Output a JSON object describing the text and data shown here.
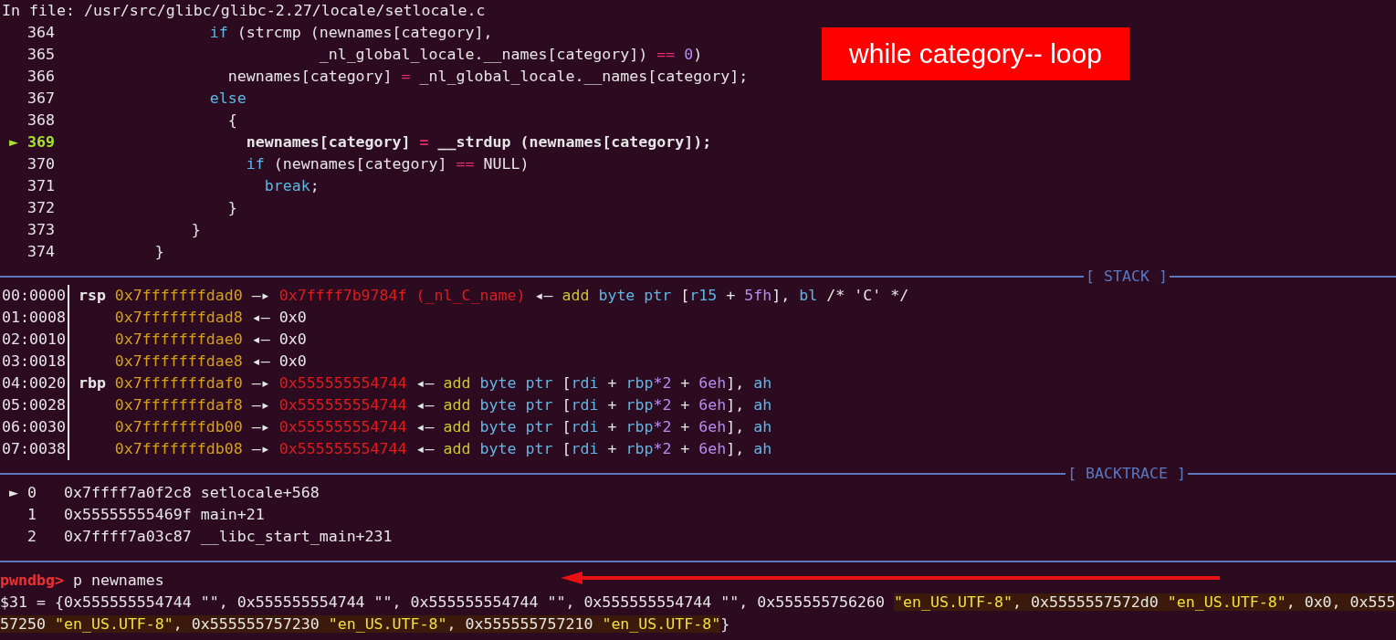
{
  "header": "In file: /usr/src/glibc/glibc-2.27/locale/setlocale.c",
  "source": [
    {
      "number": "364",
      "current": false,
      "tokens": [
        {
          "kind": "keyword",
          "text": "                 if"
        },
        {
          "kind": "plain",
          "text": " (strcmp (newnames[category],"
        }
      ]
    },
    {
      "number": "365",
      "current": false,
      "tokens": [
        {
          "kind": "plain",
          "text": "                             _nl_global_locale.__names[category]) "
        },
        {
          "kind": "operator",
          "text": "=="
        },
        {
          "kind": "number",
          "text": " 0"
        },
        {
          "kind": "plain",
          "text": ")"
        }
      ]
    },
    {
      "number": "366",
      "current": false,
      "tokens": [
        {
          "kind": "plain",
          "text": "                   newnames[category] "
        },
        {
          "kind": "operator",
          "text": "="
        },
        {
          "kind": "plain",
          "text": " _nl_global_locale.__names[category];"
        }
      ]
    },
    {
      "number": "367",
      "current": false,
      "tokens": [
        {
          "kind": "keyword",
          "text": "                 else"
        }
      ]
    },
    {
      "number": "368",
      "current": false,
      "tokens": [
        {
          "kind": "plain",
          "text": "                   {"
        }
      ]
    },
    {
      "marker": "►",
      "number": "369",
      "current": true,
      "tokens": [
        {
          "kind": "plain",
          "text": "                     newnames[category] "
        },
        {
          "kind": "operator",
          "text": "="
        },
        {
          "kind": "plain",
          "text": " __strdup (newnames[category]);"
        }
      ]
    },
    {
      "number": "370",
      "current": false,
      "tokens": [
        {
          "kind": "keyword",
          "text": "                     if"
        },
        {
          "kind": "plain",
          "text": " (newnames[category] "
        },
        {
          "kind": "operator",
          "text": "=="
        },
        {
          "kind": "plain",
          "text": " NULL)"
        }
      ]
    },
    {
      "number": "371",
      "current": false,
      "tokens": [
        {
          "kind": "keyword",
          "text": "                       break"
        },
        {
          "kind": "plain",
          "text": ";"
        }
      ]
    },
    {
      "number": "372",
      "current": false,
      "tokens": [
        {
          "kind": "plain",
          "text": "                   }"
        }
      ]
    },
    {
      "number": "373",
      "current": false,
      "tokens": [
        {
          "kind": "plain",
          "text": "               }"
        }
      ]
    },
    {
      "number": "374",
      "current": false,
      "tokens": [
        {
          "kind": "plain",
          "text": "           }"
        }
      ]
    }
  ],
  "stack": {
    "title": "[ STACK ]",
    "rows": [
      {
        "offset": "00:0000",
        "register": "rsp",
        "tokens": [
          {
            "kind": "stack",
            "text": "0x7fffffffdad0"
          },
          {
            "kind": "plain",
            "text": " —▸ "
          },
          {
            "kind": "heap",
            "text": "0x7ffff7b9784f (_nl_C_name)"
          },
          {
            "kind": "plain",
            "text": " ◂— "
          },
          {
            "kind": "mnemonic",
            "text": "add"
          },
          {
            "kind": "operand",
            "text": " byte ptr "
          },
          {
            "kind": "plain",
            "text": "["
          },
          {
            "kind": "operand",
            "text": "r15"
          },
          {
            "kind": "plain",
            "text": " + "
          },
          {
            "kind": "number",
            "text": "5fh"
          },
          {
            "kind": "plain",
            "text": "], "
          },
          {
            "kind": "operand",
            "text": "bl"
          },
          {
            "kind": "plain",
            "text": " /* 'C' */"
          }
        ]
      },
      {
        "offset": "01:0008",
        "tokens": [
          {
            "kind": "stack",
            "text": "0x7fffffffdad8"
          },
          {
            "kind": "plain",
            "text": " ◂— 0x0"
          }
        ]
      },
      {
        "offset": "02:0010",
        "tokens": [
          {
            "kind": "stack",
            "text": "0x7fffffffdae0"
          },
          {
            "kind": "plain",
            "text": " ◂— 0x0"
          }
        ]
      },
      {
        "offset": "03:0018",
        "tokens": [
          {
            "kind": "stack",
            "text": "0x7fffffffdae8"
          },
          {
            "kind": "plain",
            "text": " ◂— 0x0"
          }
        ]
      },
      {
        "offset": "04:0020",
        "register": "rbp",
        "tokens": [
          {
            "kind": "stack",
            "text": "0x7fffffffdaf0"
          },
          {
            "kind": "plain",
            "text": " —▸ "
          },
          {
            "kind": "heap",
            "text": "0x555555554744"
          },
          {
            "kind": "plain",
            "text": " ◂— "
          },
          {
            "kind": "mnemonic",
            "text": "add"
          },
          {
            "kind": "operand",
            "text": " byte ptr "
          },
          {
            "kind": "plain",
            "text": "["
          },
          {
            "kind": "operand",
            "text": "rdi"
          },
          {
            "kind": "plain",
            "text": " + "
          },
          {
            "kind": "operand",
            "text": "rbp"
          },
          {
            "kind": "number",
            "text": "*2"
          },
          {
            "kind": "plain",
            "text": " + "
          },
          {
            "kind": "number",
            "text": "6eh"
          },
          {
            "kind": "plain",
            "text": "], "
          },
          {
            "kind": "operand",
            "text": "ah"
          }
        ]
      },
      {
        "offset": "05:0028",
        "tokens": [
          {
            "kind": "stack",
            "text": "0x7fffffffdaf8"
          },
          {
            "kind": "plain",
            "text": " —▸ "
          },
          {
            "kind": "heap",
            "text": "0x555555554744"
          },
          {
            "kind": "plain",
            "text": " ◂— "
          },
          {
            "kind": "mnemonic",
            "text": "add"
          },
          {
            "kind": "operand",
            "text": " byte ptr "
          },
          {
            "kind": "plain",
            "text": "["
          },
          {
            "kind": "operand",
            "text": "rdi"
          },
          {
            "kind": "plain",
            "text": " + "
          },
          {
            "kind": "operand",
            "text": "rbp"
          },
          {
            "kind": "number",
            "text": "*2"
          },
          {
            "kind": "plain",
            "text": " + "
          },
          {
            "kind": "number",
            "text": "6eh"
          },
          {
            "kind": "plain",
            "text": "], "
          },
          {
            "kind": "operand",
            "text": "ah"
          }
        ]
      },
      {
        "offset": "06:0030",
        "tokens": [
          {
            "kind": "stack",
            "text": "0x7fffffffdb00"
          },
          {
            "kind": "plain",
            "text": " —▸ "
          },
          {
            "kind": "heap",
            "text": "0x555555554744"
          },
          {
            "kind": "plain",
            "text": " ◂— "
          },
          {
            "kind": "mnemonic",
            "text": "add"
          },
          {
            "kind": "operand",
            "text": " byte ptr "
          },
          {
            "kind": "plain",
            "text": "["
          },
          {
            "kind": "operand",
            "text": "rdi"
          },
          {
            "kind": "plain",
            "text": " + "
          },
          {
            "kind": "operand",
            "text": "rbp"
          },
          {
            "kind": "number",
            "text": "*2"
          },
          {
            "kind": "plain",
            "text": " + "
          },
          {
            "kind": "number",
            "text": "6eh"
          },
          {
            "kind": "plain",
            "text": "], "
          },
          {
            "kind": "operand",
            "text": "ah"
          }
        ]
      },
      {
        "offset": "07:0038",
        "tokens": [
          {
            "kind": "stack",
            "text": "0x7fffffffdb08"
          },
          {
            "kind": "plain",
            "text": " —▸ "
          },
          {
            "kind": "heap",
            "text": "0x555555554744"
          },
          {
            "kind": "plain",
            "text": " ◂— "
          },
          {
            "kind": "mnemonic",
            "text": "add"
          },
          {
            "kind": "operand",
            "text": " byte ptr "
          },
          {
            "kind": "plain",
            "text": "["
          },
          {
            "kind": "operand",
            "text": "rdi"
          },
          {
            "kind": "plain",
            "text": " + "
          },
          {
            "kind": "operand",
            "text": "rbp"
          },
          {
            "kind": "number",
            "text": "*2"
          },
          {
            "kind": "plain",
            "text": " + "
          },
          {
            "kind": "number",
            "text": "6eh"
          },
          {
            "kind": "plain",
            "text": "], "
          },
          {
            "kind": "operand",
            "text": "ah"
          }
        ]
      }
    ]
  },
  "backtrace": {
    "title": "[ BACKTRACE ]",
    "frames": [
      {
        "marker": "►",
        "index": "0",
        "address": "0x7ffff7a0f2c8",
        "symbol": "setlocale+568"
      },
      {
        "index": "1",
        "address": "0x55555555469f",
        "symbol": "main+21"
      },
      {
        "index": "2",
        "address": "0x7ffff7a03c87",
        "symbol": "__libc_start_main+231"
      }
    ]
  },
  "console": {
    "prompt": "pwndbg>",
    "command": "p newnames",
    "output": [
      [
        {
          "kind": "plain",
          "highlighted": false,
          "text": "$31 = {0x555555554744 \"\", 0x555555554744 \"\", 0x555555554744 \"\", 0x555555554744 \"\", 0x555555756260 "
        },
        {
          "kind": "string",
          "highlighted": true,
          "text": "\"en_US.UTF-8\""
        },
        {
          "kind": "plain",
          "highlighted": true,
          "text": ", 0x5555557572d0 "
        },
        {
          "kind": "string",
          "highlighted": true,
          "text": "\"en_US.UTF-8\""
        },
        {
          "kind": "plain",
          "highlighted": true,
          "text": ", 0x0, 0x555"
        }
      ],
      [
        {
          "kind": "plain",
          "highlighted": true,
          "text": "57250 "
        },
        {
          "kind": "string",
          "highlighted": true,
          "text": "\"en_US.UTF-8\""
        },
        {
          "kind": "plain",
          "highlighted": true,
          "text": ", 0x555555757230 "
        },
        {
          "kind": "string",
          "highlighted": true,
          "text": "\"en_US.UTF-8\""
        },
        {
          "kind": "plain",
          "highlighted": true,
          "text": ", 0x555555757210 "
        },
        {
          "kind": "string",
          "highlighted": true,
          "text": "\"en_US.UTF-8\""
        },
        {
          "kind": "plain",
          "highlighted": false,
          "text": "}"
        }
      ]
    ]
  },
  "annotation": {
    "text": "while category-- loop"
  }
}
